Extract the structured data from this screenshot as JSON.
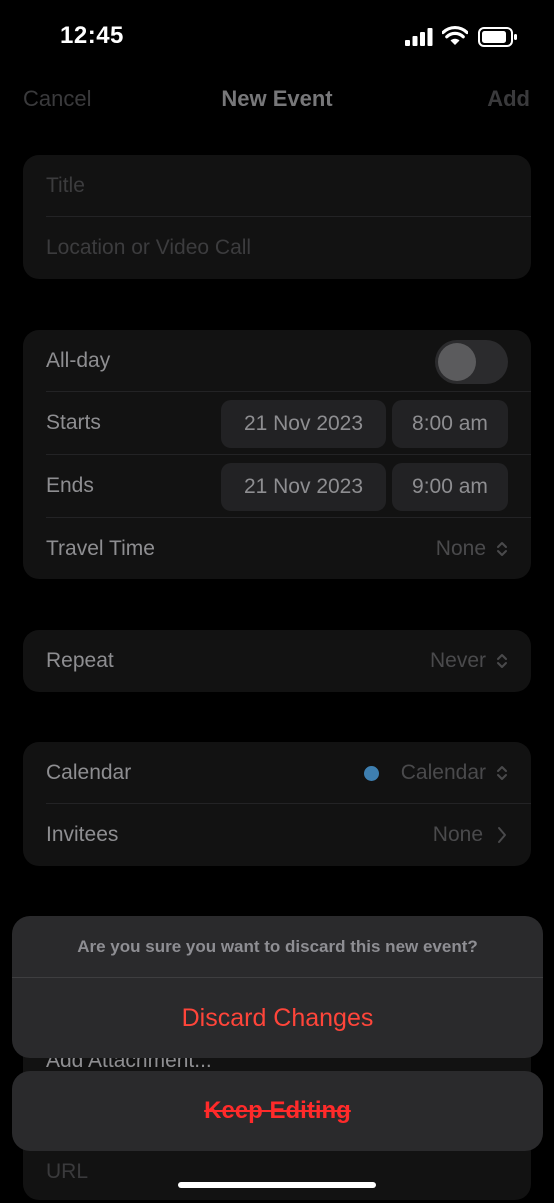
{
  "status_bar": {
    "time": "12:45",
    "icons": [
      "signal-icon",
      "wifi-icon",
      "battery-icon"
    ]
  },
  "nav": {
    "cancel": "Cancel",
    "title": "New Event",
    "add": "Add"
  },
  "title_card": {
    "title_placeholder": "Title",
    "location_placeholder": "Location or Video Call"
  },
  "date_card": {
    "all_day": "All-day",
    "all_day_on": false,
    "starts_label": "Starts",
    "starts_date": "21 Nov 2023",
    "starts_time": "8:00 am",
    "ends_label": "Ends",
    "ends_date": "21 Nov 2023",
    "ends_time": "9:00 am",
    "travel_label": "Travel Time",
    "travel_value": "None"
  },
  "repeat_card": {
    "label": "Repeat",
    "value": "Never"
  },
  "calendar_card": {
    "calendar_label": "Calendar",
    "calendar_value": "Calendar",
    "calendar_color": "#3e7fb0",
    "invitees_label": "Invitees",
    "invitees_value": "None"
  },
  "behind_sheet": {
    "attachment": "Add Attachment...",
    "url_placeholder": "URL"
  },
  "action_sheet": {
    "message": "Are you sure you want to discard this new event?",
    "discard": "Discard Changes",
    "keep": "Keep Editing"
  },
  "colors": {
    "destructive": "#ff453a",
    "background": "#000000",
    "card": "#121212"
  }
}
